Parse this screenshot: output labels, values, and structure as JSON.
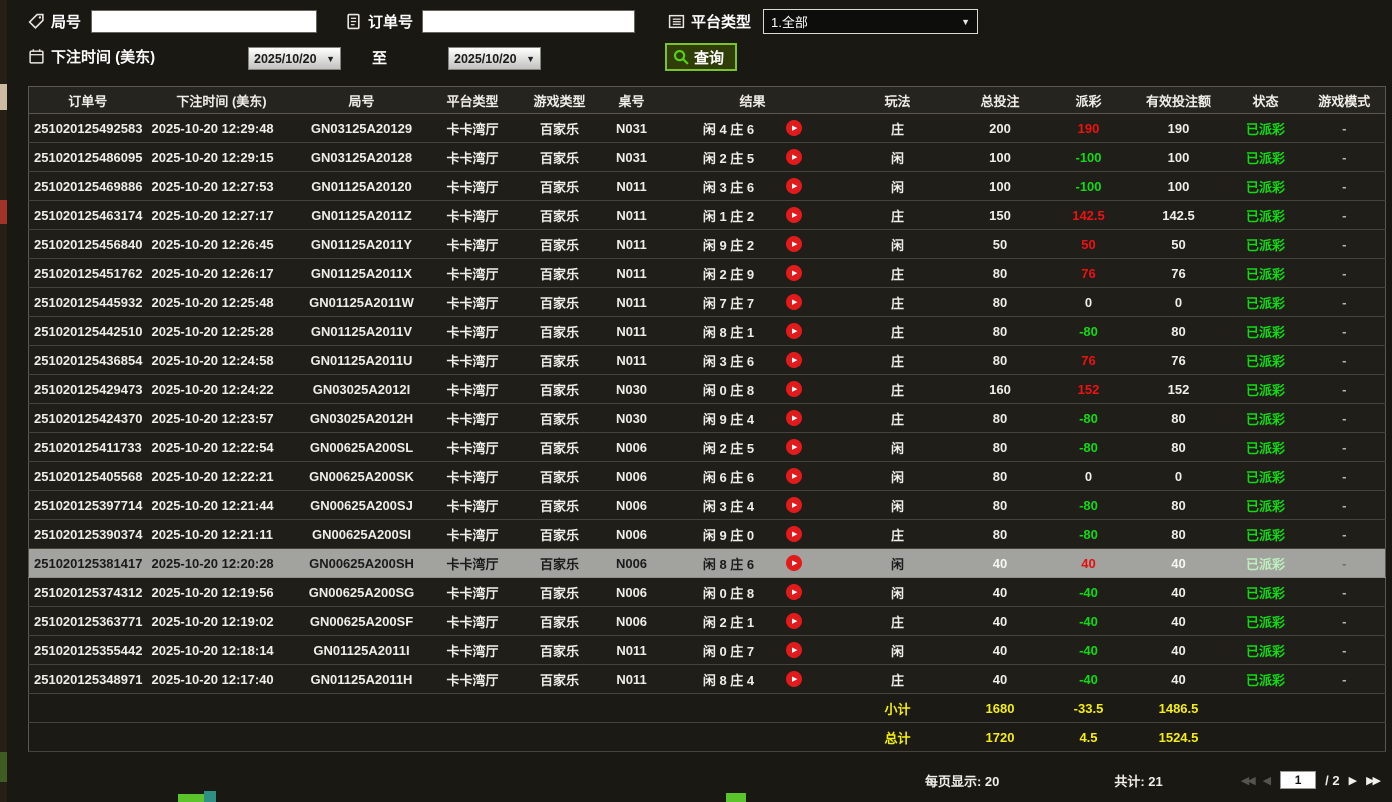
{
  "filter_bar": {
    "game_no": {
      "label": "局号",
      "value": ""
    },
    "order_no": {
      "label": "订单号",
      "value": ""
    },
    "platform": {
      "label": "平台类型",
      "selected": "1.全部"
    },
    "bet_time": {
      "label": "下注时间 (美东)",
      "from": "2025/10/20",
      "to_label": "至",
      "to": "2025/10/20"
    },
    "query_button": "查询"
  },
  "icons": {
    "dropdown_arrow": "▼",
    "play_button": "▶",
    "page_first": "◀◀",
    "page_prev": "◀",
    "page_next": "▶",
    "page_last": "▶▶"
  },
  "colors": {
    "payout_win": "#ee1212",
    "payout_loss": "#12da12",
    "status_paid": "#12da12",
    "summary_yellow": "#f4ef10",
    "query_border_green": "#79c42d",
    "play_icon_red": "#e11b1b"
  },
  "table": {
    "headers": [
      "订单号",
      "下注时间 (美东)",
      "局号",
      "平台类型",
      "游戏类型",
      "桌号",
      "结果",
      "玩法",
      "总投注",
      "派彩",
      "有效投注额",
      "状态",
      "游戏模式"
    ],
    "rows": [
      {
        "order": "251020125492583",
        "time": "2025-10-20 12:29:48",
        "game": "GN03125A20129",
        "platform": "卡卡湾厅",
        "type": "百家乐",
        "table_no": "N031",
        "result": "闲 4 庄 6",
        "play": "庄",
        "total": "200",
        "payout": "190",
        "payout_class": "win",
        "valid": "190",
        "status": "已派彩",
        "mode": "-"
      },
      {
        "order": "251020125486095",
        "time": "2025-10-20 12:29:15",
        "game": "GN03125A20128",
        "platform": "卡卡湾厅",
        "type": "百家乐",
        "table_no": "N031",
        "result": "闲 2 庄 5",
        "play": "闲",
        "total": "100",
        "payout": "-100",
        "payout_class": "loss",
        "valid": "100",
        "status": "已派彩",
        "mode": "-"
      },
      {
        "order": "251020125469886",
        "time": "2025-10-20 12:27:53",
        "game": "GN01125A20120",
        "platform": "卡卡湾厅",
        "type": "百家乐",
        "table_no": "N011",
        "result": "闲 3 庄 6",
        "play": "闲",
        "total": "100",
        "payout": "-100",
        "payout_class": "loss",
        "valid": "100",
        "status": "已派彩",
        "mode": "-"
      },
      {
        "order": "251020125463174",
        "time": "2025-10-20 12:27:17",
        "game": "GN01125A2011Z",
        "platform": "卡卡湾厅",
        "type": "百家乐",
        "table_no": "N011",
        "result": "闲 1 庄 2",
        "play": "庄",
        "total": "150",
        "payout": "142.5",
        "payout_class": "win",
        "valid": "142.5",
        "status": "已派彩",
        "mode": "-"
      },
      {
        "order": "251020125456840",
        "time": "2025-10-20 12:26:45",
        "game": "GN01125A2011Y",
        "platform": "卡卡湾厅",
        "type": "百家乐",
        "table_no": "N011",
        "result": "闲 9 庄 2",
        "play": "闲",
        "total": "50",
        "payout": "50",
        "payout_class": "win",
        "valid": "50",
        "status": "已派彩",
        "mode": "-"
      },
      {
        "order": "251020125451762",
        "time": "2025-10-20 12:26:17",
        "game": "GN01125A2011X",
        "platform": "卡卡湾厅",
        "type": "百家乐",
        "table_no": "N011",
        "result": "闲 2 庄 9",
        "play": "庄",
        "total": "80",
        "payout": "76",
        "payout_class": "win",
        "valid": "76",
        "status": "已派彩",
        "mode": "-"
      },
      {
        "order": "251020125445932",
        "time": "2025-10-20 12:25:48",
        "game": "GN01125A2011W",
        "platform": "卡卡湾厅",
        "type": "百家乐",
        "table_no": "N011",
        "result": "闲 7 庄 7",
        "play": "庄",
        "total": "80",
        "payout": "0",
        "payout_class": "zero",
        "valid": "0",
        "status": "已派彩",
        "mode": "-"
      },
      {
        "order": "251020125442510",
        "time": "2025-10-20 12:25:28",
        "game": "GN01125A2011V",
        "platform": "卡卡湾厅",
        "type": "百家乐",
        "table_no": "N011",
        "result": "闲 8 庄 1",
        "play": "庄",
        "total": "80",
        "payout": "-80",
        "payout_class": "loss",
        "valid": "80",
        "status": "已派彩",
        "mode": "-"
      },
      {
        "order": "251020125436854",
        "time": "2025-10-20 12:24:58",
        "game": "GN01125A2011U",
        "platform": "卡卡湾厅",
        "type": "百家乐",
        "table_no": "N011",
        "result": "闲 3 庄 6",
        "play": "庄",
        "total": "80",
        "payout": "76",
        "payout_class": "win",
        "valid": "76",
        "status": "已派彩",
        "mode": "-"
      },
      {
        "order": "251020125429473",
        "time": "2025-10-20 12:24:22",
        "game": "GN03025A2012I",
        "platform": "卡卡湾厅",
        "type": "百家乐",
        "table_no": "N030",
        "result": "闲 0 庄 8",
        "play": "庄",
        "total": "160",
        "payout": "152",
        "payout_class": "win",
        "valid": "152",
        "status": "已派彩",
        "mode": "-"
      },
      {
        "order": "251020125424370",
        "time": "2025-10-20 12:23:57",
        "game": "GN03025A2012H",
        "platform": "卡卡湾厅",
        "type": "百家乐",
        "table_no": "N030",
        "result": "闲 9 庄 4",
        "play": "庄",
        "total": "80",
        "payout": "-80",
        "payout_class": "loss",
        "valid": "80",
        "status": "已派彩",
        "mode": "-"
      },
      {
        "order": "251020125411733",
        "time": "2025-10-20 12:22:54",
        "game": "GN00625A200SL",
        "platform": "卡卡湾厅",
        "type": "百家乐",
        "table_no": "N006",
        "result": "闲 2 庄 5",
        "play": "闲",
        "total": "80",
        "payout": "-80",
        "payout_class": "loss",
        "valid": "80",
        "status": "已派彩",
        "mode": "-"
      },
      {
        "order": "251020125405568",
        "time": "2025-10-20 12:22:21",
        "game": "GN00625A200SK",
        "platform": "卡卡湾厅",
        "type": "百家乐",
        "table_no": "N006",
        "result": "闲 6 庄 6",
        "play": "闲",
        "total": "80",
        "payout": "0",
        "payout_class": "zero",
        "valid": "0",
        "status": "已派彩",
        "mode": "-"
      },
      {
        "order": "251020125397714",
        "time": "2025-10-20 12:21:44",
        "game": "GN00625A200SJ",
        "platform": "卡卡湾厅",
        "type": "百家乐",
        "table_no": "N006",
        "result": "闲 3 庄 4",
        "play": "闲",
        "total": "80",
        "payout": "-80",
        "payout_class": "loss",
        "valid": "80",
        "status": "已派彩",
        "mode": "-"
      },
      {
        "order": "251020125390374",
        "time": "2025-10-20 12:21:11",
        "game": "GN00625A200SI",
        "platform": "卡卡湾厅",
        "type": "百家乐",
        "table_no": "N006",
        "result": "闲 9 庄 0",
        "play": "庄",
        "total": "80",
        "payout": "-80",
        "payout_class": "loss",
        "valid": "80",
        "status": "已派彩",
        "mode": "-"
      },
      {
        "order": "251020125381417",
        "time": "2025-10-20 12:20:28",
        "game": "GN00625A200SH",
        "platform": "卡卡湾厅",
        "type": "百家乐",
        "table_no": "N006",
        "result": "闲 8 庄 6",
        "play": "闲",
        "total": "40",
        "payout": "40",
        "payout_class": "win",
        "valid": "40",
        "status": "已派彩",
        "mode": "-",
        "selected": true
      },
      {
        "order": "251020125374312",
        "time": "2025-10-20 12:19:56",
        "game": "GN00625A200SG",
        "platform": "卡卡湾厅",
        "type": "百家乐",
        "table_no": "N006",
        "result": "闲 0 庄 8",
        "play": "闲",
        "total": "40",
        "payout": "-40",
        "payout_class": "loss",
        "valid": "40",
        "status": "已派彩",
        "mode": "-"
      },
      {
        "order": "251020125363771",
        "time": "2025-10-20 12:19:02",
        "game": "GN00625A200SF",
        "platform": "卡卡湾厅",
        "type": "百家乐",
        "table_no": "N006",
        "result": "闲 2 庄 1",
        "play": "庄",
        "total": "40",
        "payout": "-40",
        "payout_class": "loss",
        "valid": "40",
        "status": "已派彩",
        "mode": "-"
      },
      {
        "order": "251020125355442",
        "time": "2025-10-20 12:18:14",
        "game": "GN01125A2011I",
        "platform": "卡卡湾厅",
        "type": "百家乐",
        "table_no": "N011",
        "result": "闲 0 庄 7",
        "play": "闲",
        "total": "40",
        "payout": "-40",
        "payout_class": "loss",
        "valid": "40",
        "status": "已派彩",
        "mode": "-"
      },
      {
        "order": "251020125348971",
        "time": "2025-10-20 12:17:40",
        "game": "GN01125A2011H",
        "platform": "卡卡湾厅",
        "type": "百家乐",
        "table_no": "N011",
        "result": "闲 8 庄 4",
        "play": "庄",
        "total": "40",
        "payout": "-40",
        "payout_class": "loss",
        "valid": "40",
        "status": "已派彩",
        "mode": "-"
      }
    ],
    "subtotal": {
      "label": "小计",
      "total_bet": "1680",
      "payout": "-33.5",
      "valid_bet": "1486.5"
    },
    "grand_total": {
      "label": "总计",
      "total_bet": "1720",
      "payout": "4.5",
      "valid_bet": "1524.5"
    }
  },
  "footer": {
    "per_page": "每页显示: 20",
    "total_count": "共计: 21",
    "page_value": "1",
    "page_total": "/ 2"
  }
}
